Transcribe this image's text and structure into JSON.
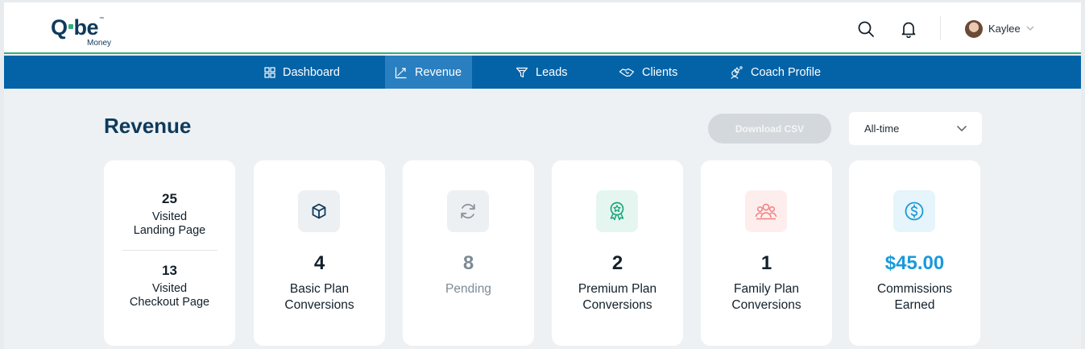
{
  "header": {
    "logo": {
      "main": "Qube",
      "sub": "Money",
      "tm": "™"
    },
    "user": {
      "name": "Kaylee"
    }
  },
  "nav": {
    "items": [
      {
        "label": "Dashboard",
        "icon": "grid-icon",
        "active": false
      },
      {
        "label": "Revenue",
        "icon": "trend-up-icon",
        "active": true
      },
      {
        "label": "Leads",
        "icon": "filter-icon",
        "active": false
      },
      {
        "label": "Clients",
        "icon": "handshake-icon",
        "active": false
      },
      {
        "label": "Coach Profile",
        "icon": "coach-icon",
        "active": false
      }
    ]
  },
  "page": {
    "title": "Revenue",
    "download_label": "Download CSV",
    "period_select": {
      "value": "All-time"
    }
  },
  "cards": {
    "visits": [
      {
        "value": "25",
        "label_line1": "Visited",
        "label_line2": "Landing Page"
      },
      {
        "value": "13",
        "label_line1": "Visited",
        "label_line2": "Checkout Page"
      }
    ],
    "stats": [
      {
        "value": "4",
        "label_line1": "Basic Plan",
        "label_line2": "Conversions",
        "icon": "cube-icon",
        "accent": "#0e3a5c",
        "icon_bg": "#edf0f2",
        "value_color": "#12202b"
      },
      {
        "value": "8",
        "label_line1": "Pending",
        "label_line2": "",
        "icon": "refresh-icon",
        "accent": "#8a949c",
        "icon_bg": "#edf0f2",
        "value_color": "#7d8a95"
      },
      {
        "value": "2",
        "label_line1": "Premium Plan",
        "label_line2": "Conversions",
        "icon": "award-icon",
        "accent": "#1aa77a",
        "icon_bg": "#e5f6f0",
        "value_color": "#12202b"
      },
      {
        "value": "1",
        "label_line1": "Family Plan",
        "label_line2": "Conversions",
        "icon": "family-icon",
        "accent": "#f08080",
        "icon_bg": "#fdeeed",
        "value_color": "#12202b"
      },
      {
        "value": "$45.00",
        "label_line1": "Commissions",
        "label_line2": "Earned",
        "icon": "dollar-icon",
        "accent": "#1a9ad9",
        "icon_bg": "#e6f4fb",
        "value_color": "#1a9ad9"
      }
    ]
  }
}
